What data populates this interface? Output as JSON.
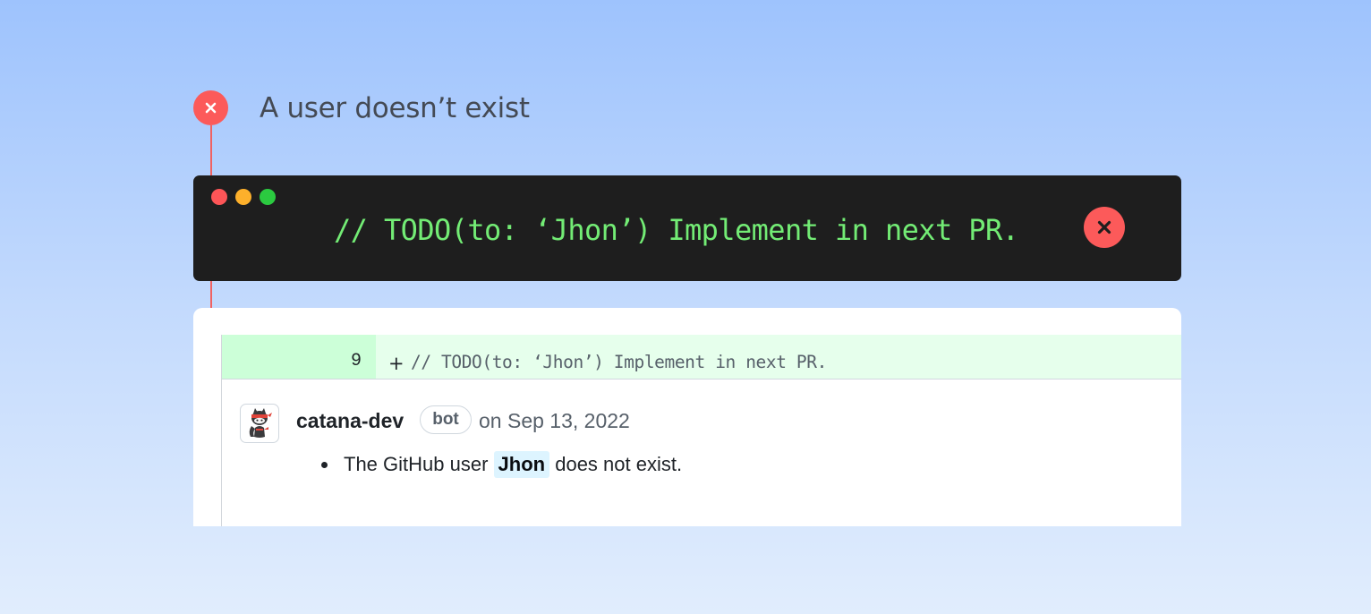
{
  "header": {
    "title": "A user doesn’t exist",
    "status_icon": "x-icon"
  },
  "terminal": {
    "window_controls": [
      "red",
      "yellow",
      "green"
    ],
    "code": "// TODO(to: ‘Jhon’) Implement in next PR.",
    "result_icon": "x-icon"
  },
  "diff": {
    "line_number": "9",
    "marker": "+",
    "code": "// TODO(to: ‘Jhon’) Implement in next PR."
  },
  "comment": {
    "author": "catana-dev",
    "badge": "bot",
    "date": "on Sep 13, 2022",
    "body_prefix": "The GitHub user",
    "mention": "Jhon",
    "body_suffix": "does not exist."
  },
  "colors": {
    "error": "#fc5a5a",
    "terminal_bg": "#1e1e1e",
    "terminal_text": "#73ec75",
    "diff_added_bg": "#e6ffec",
    "diff_line_num_bg": "#ccffd8",
    "mention_bg": "#ddf4ff"
  }
}
